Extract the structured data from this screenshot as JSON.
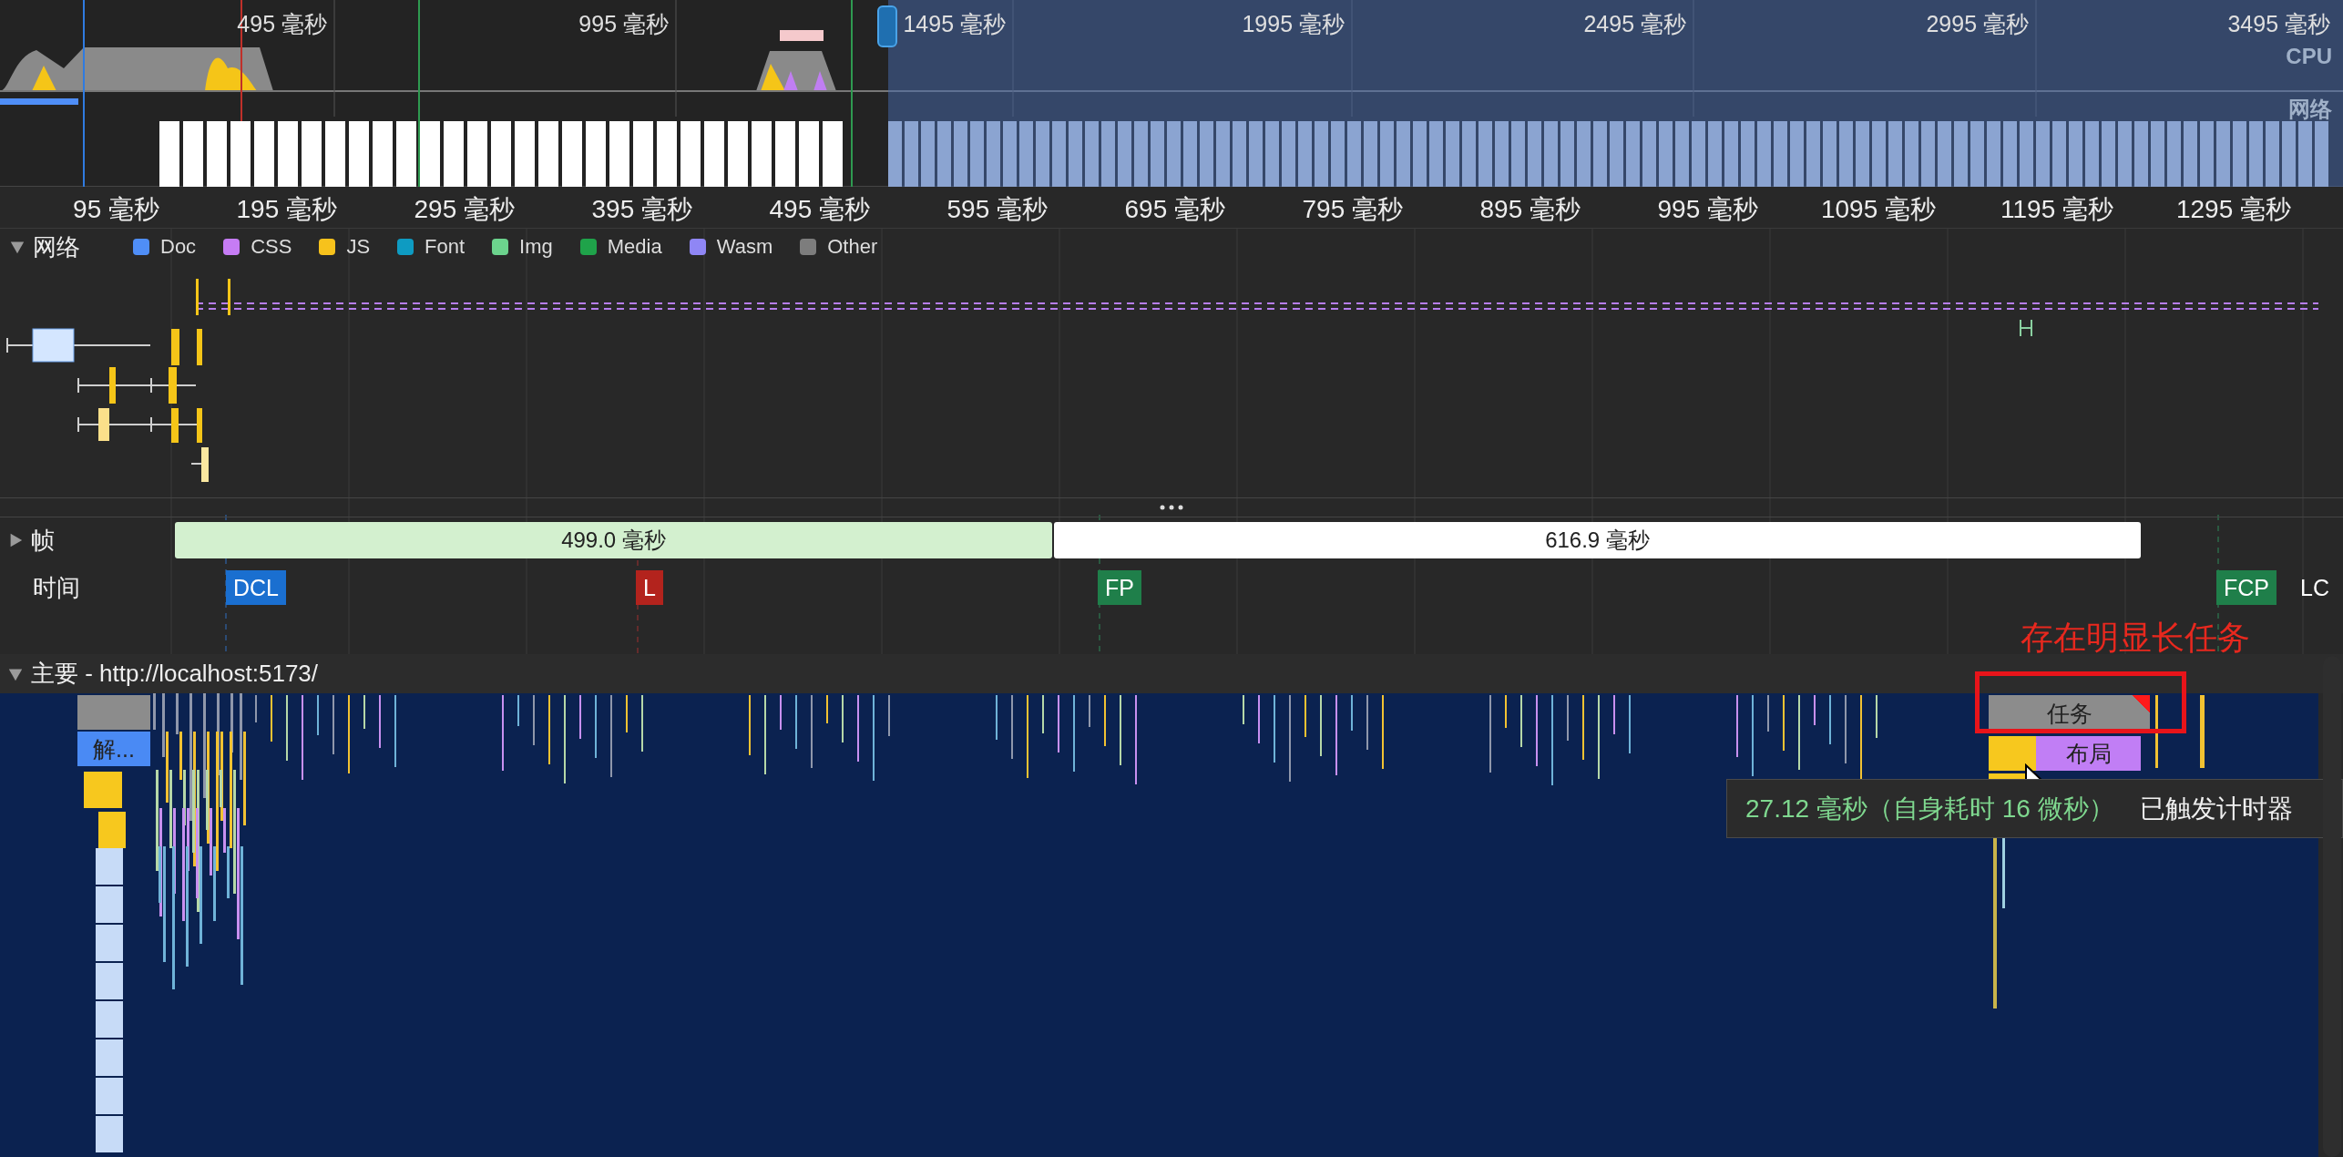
{
  "overview": {
    "time_labels": [
      "495 毫秒",
      "995 毫秒",
      "1495 毫秒",
      "1995 毫秒",
      "2495 毫秒",
      "2995 毫秒",
      "3495 毫秒"
    ],
    "track_labels": [
      "CPU",
      "网络"
    ]
  },
  "ruler": {
    "ticks": [
      "95 毫秒",
      "195 毫秒",
      "295 毫秒",
      "395 毫秒",
      "495 毫秒",
      "595 毫秒",
      "695 毫秒",
      "795 毫秒",
      "895 毫秒",
      "995 毫秒",
      "1095 毫秒",
      "1195 毫秒",
      "1295 毫秒"
    ]
  },
  "network": {
    "title": "网络",
    "expanded": true,
    "legend": [
      {
        "label": "Doc",
        "color": "#4f8ef7"
      },
      {
        "label": "CSS",
        "color": "#c67cf5"
      },
      {
        "label": "JS",
        "color": "#f7c21c"
      },
      {
        "label": "Font",
        "color": "#0e9bc2"
      },
      {
        "label": "Img",
        "color": "#6cd38d"
      },
      {
        "label": "Media",
        "color": "#1fa34a"
      },
      {
        "label": "Wasm",
        "color": "#8f86f5"
      },
      {
        "label": "Other",
        "color": "#7d7d7d"
      }
    ]
  },
  "frames": {
    "title": "帧",
    "expanded": false,
    "bars": [
      {
        "label": "499.0 毫秒",
        "color": "#d3f0cf"
      },
      {
        "label": "616.9 毫秒",
        "color": "#ffffff"
      }
    ]
  },
  "timings": {
    "title": "时间",
    "markers": [
      {
        "label": "DCL",
        "color": "#1a6fd0"
      },
      {
        "label": "L",
        "color": "#b3231d"
      },
      {
        "label": "FP",
        "color": "#1f7f4a"
      },
      {
        "label": "FCP",
        "color": "#1f7f4a"
      },
      {
        "label": "LC"
      }
    ]
  },
  "annotation": "存在明显长任务",
  "main": {
    "title": "主要 - http://localhost:5173/",
    "expanded": true,
    "events": [
      {
        "label": "解...",
        "kind": "parse",
        "long": false
      },
      {
        "label": "任务",
        "kind": "task",
        "long": true
      },
      {
        "label": "布局",
        "kind": "layout",
        "long": false
      }
    ]
  },
  "tooltip": {
    "duration": "27.12 毫秒（自身耗时 16 微秒）",
    "title": "已触发计时器"
  }
}
